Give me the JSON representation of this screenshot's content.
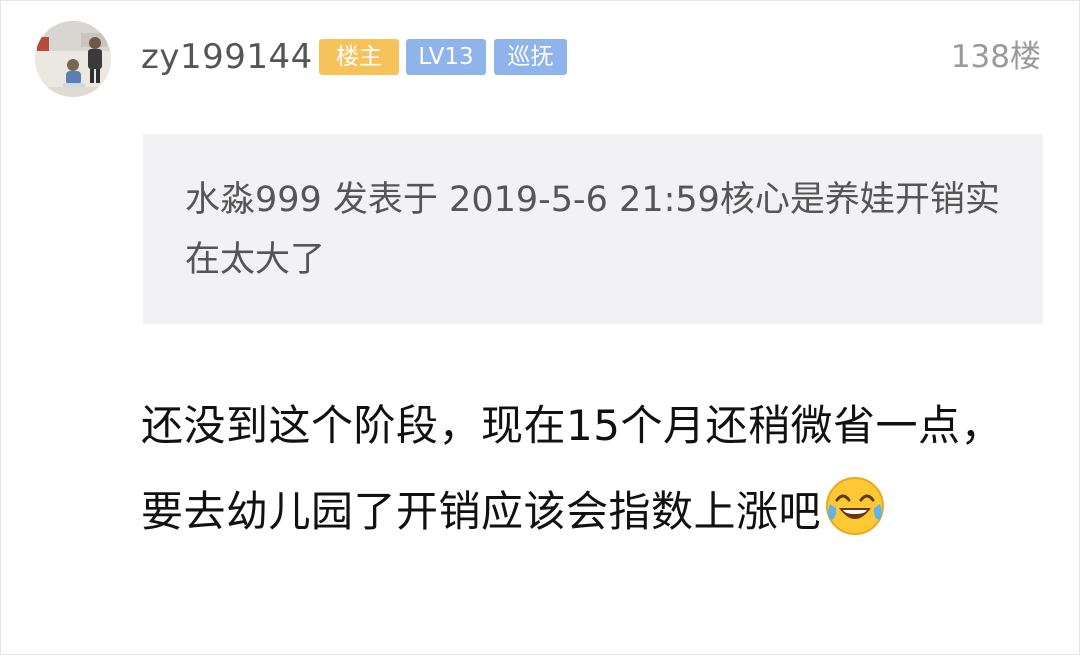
{
  "post": {
    "username": "zy199144",
    "badges": {
      "owner": "楼主",
      "level": "LV13",
      "role": "巡抚"
    },
    "floor": "138楼",
    "quote": {
      "text": "水淼999 发表于 2019-5-6 21:59核心是养娃开销实在太大了"
    },
    "content": "还没到这个阶段，现在15个月还稍微省一点，要去幼儿园了开销应该会指数上涨吧",
    "emoji": "laughing-crying-emoji"
  },
  "colors": {
    "owner_badge": "#f6c35b",
    "level_badge": "#8fb4ec",
    "quote_bg": "#f2f2f4"
  }
}
